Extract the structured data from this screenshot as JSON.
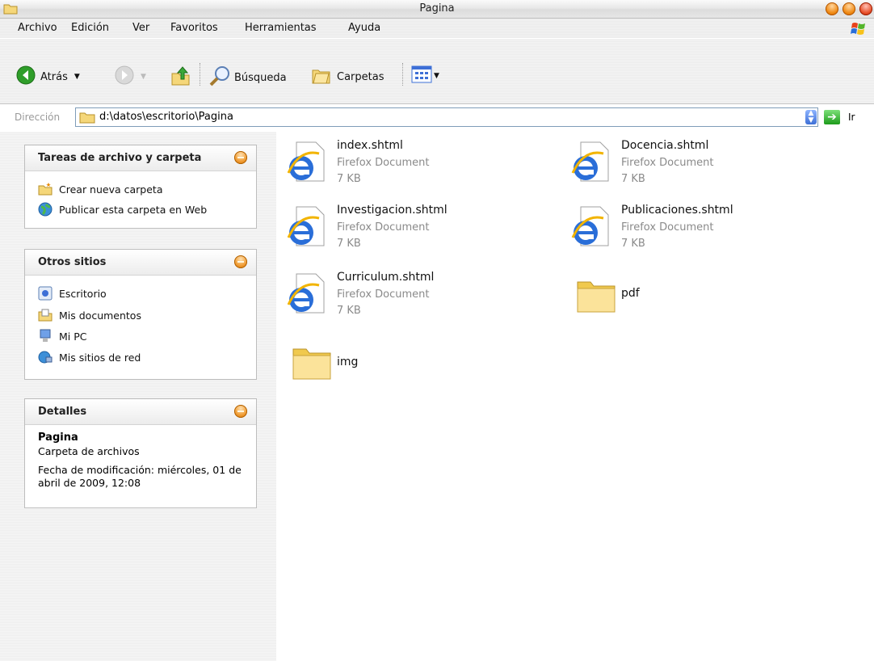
{
  "window": {
    "title": "Pagina"
  },
  "menu": [
    "Archivo",
    "Edición",
    "Ver",
    "Favoritos",
    "Herramientas",
    "Ayuda"
  ],
  "toolbar": {
    "back_label": "Atrás",
    "search_label": "Búsqueda",
    "folders_label": "Carpetas"
  },
  "address": {
    "label": "Dirección",
    "value": "d:\\datos\\escritorio\\Pagina",
    "go_label": "Ir"
  },
  "panels": {
    "tasks": {
      "title": "Tareas de archivo y carpeta",
      "items": [
        "Crear nueva carpeta",
        "Publicar esta carpeta en Web"
      ]
    },
    "places": {
      "title": "Otros sitios",
      "items": [
        "Escritorio",
        "Mis documentos",
        "Mi PC",
        "Mis sitios de red"
      ]
    },
    "details": {
      "title": "Detalles",
      "name": "Pagina",
      "type": "Carpeta de archivos",
      "modified": "Fecha de modificación: miércoles, 01 de abril de 2009, 12:08"
    }
  },
  "files": [
    {
      "name": "index.shtml",
      "type": "Firefox Document",
      "size": "7 KB",
      "icon": "ie-document-icon"
    },
    {
      "name": "Docencia.shtml",
      "type": "Firefox Document",
      "size": "7 KB",
      "icon": "ie-document-icon"
    },
    {
      "name": "Investigacion.shtml",
      "type": "Firefox Document",
      "size": "7 KB",
      "icon": "ie-document-icon"
    },
    {
      "name": "Publicaciones.shtml",
      "type": "Firefox Document",
      "size": "7 KB",
      "icon": "ie-document-icon"
    },
    {
      "name": "Curriculum.shtml",
      "type": "Firefox Document",
      "size": "7 KB",
      "icon": "ie-document-icon"
    },
    {
      "name": "pdf",
      "icon": "folder-icon"
    },
    {
      "name": "img",
      "icon": "folder-icon"
    }
  ]
}
